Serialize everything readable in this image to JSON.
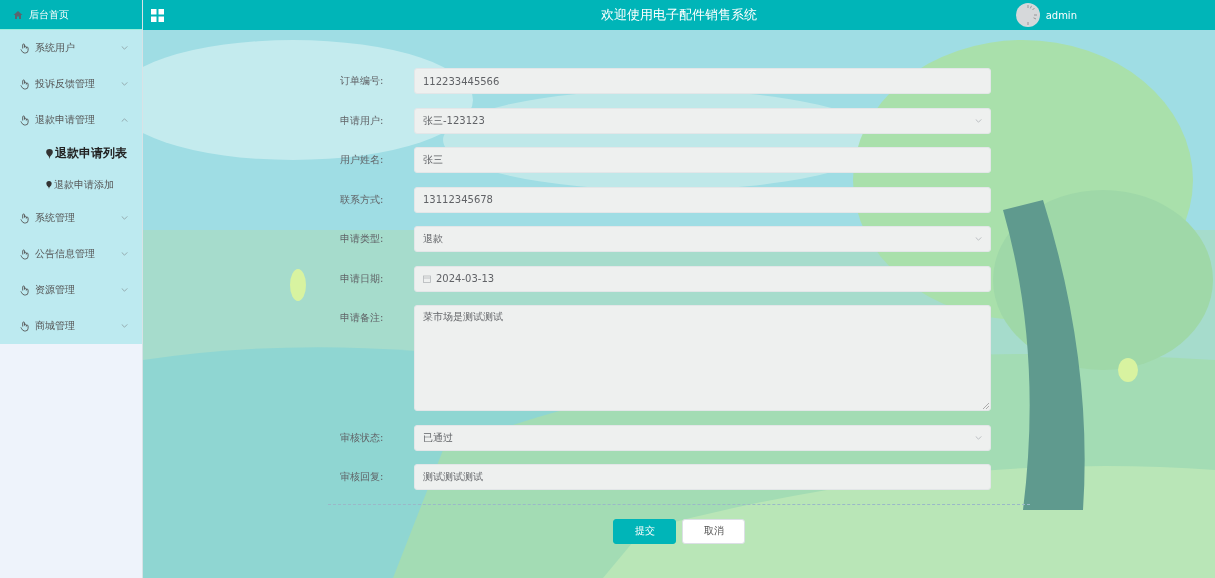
{
  "sidebar": {
    "home": "后台首页",
    "items": [
      {
        "label": "系统用户",
        "expanded": false
      },
      {
        "label": "投诉反馈管理",
        "expanded": false
      },
      {
        "label": "退款申请管理",
        "expanded": true,
        "children": [
          {
            "label": "退款申请列表",
            "selected": true
          },
          {
            "label": "退款申请添加",
            "selected": false
          }
        ]
      },
      {
        "label": "系统管理",
        "expanded": false
      },
      {
        "label": "公告信息管理",
        "expanded": false
      },
      {
        "label": "资源管理",
        "expanded": false
      },
      {
        "label": "商城管理",
        "expanded": false
      }
    ]
  },
  "header": {
    "title": "欢迎使用电子配件销售系统",
    "user": "admin"
  },
  "form": {
    "fields": [
      {
        "label": "订单编号:",
        "kind": "input",
        "value": "112233445566"
      },
      {
        "label": "申请用户:",
        "kind": "select",
        "value": "张三-123123"
      },
      {
        "label": "用户姓名:",
        "kind": "input",
        "value": "张三"
      },
      {
        "label": "联系方式:",
        "kind": "input",
        "value": "13112345678"
      },
      {
        "label": "申请类型:",
        "kind": "select",
        "value": "退款"
      },
      {
        "label": "申请日期:",
        "kind": "date",
        "value": "2024-03-13"
      },
      {
        "label": "申请备注:",
        "kind": "textarea",
        "value": "菜市场是测试测试"
      },
      {
        "label": "审核状态:",
        "kind": "select",
        "value": "已通过"
      },
      {
        "label": "审核回复:",
        "kind": "input",
        "value": "测试测试测试"
      }
    ],
    "buttons": [
      {
        "label": "提交",
        "kind": "primary"
      },
      {
        "label": "取消",
        "kind": "plain"
      }
    ]
  }
}
